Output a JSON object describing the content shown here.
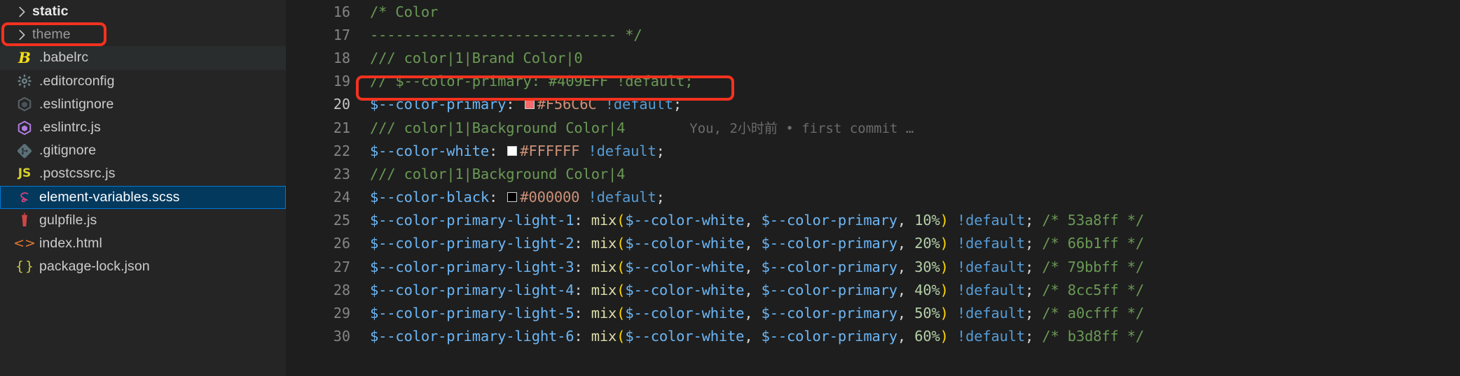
{
  "sidebar": {
    "items": [
      {
        "label": "static",
        "icon": "chevron-right-icon",
        "type": "folder",
        "state": "normal"
      },
      {
        "label": "theme",
        "icon": "chevron-right-icon",
        "type": "folder",
        "state": "annotated"
      },
      {
        "label": ".babelrc",
        "icon": "babel-icon",
        "type": "file",
        "state": "hovered"
      },
      {
        "label": ".editorconfig",
        "icon": "gear-icon",
        "type": "file",
        "state": "normal"
      },
      {
        "label": ".eslintignore",
        "icon": "eslint-gray-icon",
        "type": "file",
        "state": "normal"
      },
      {
        "label": ".eslintrc.js",
        "icon": "eslint-purple-icon",
        "type": "file",
        "state": "normal"
      },
      {
        "label": ".gitignore",
        "icon": "git-icon",
        "type": "file",
        "state": "normal"
      },
      {
        "label": ".postcssrc.js",
        "icon": "js-icon",
        "type": "file",
        "state": "normal"
      },
      {
        "label": "element-variables.scss",
        "icon": "sass-icon",
        "type": "file",
        "state": "selected"
      },
      {
        "label": "gulpfile.js",
        "icon": "gulp-icon",
        "type": "file",
        "state": "normal"
      },
      {
        "label": "index.html",
        "icon": "html-icon",
        "type": "file",
        "state": "normal"
      },
      {
        "label": "package-lock.json",
        "icon": "json-icon",
        "type": "file",
        "state": "normal"
      }
    ]
  },
  "annotations": {
    "sidebar_box_color": "#f3321f",
    "code_box_color": "#f3321f",
    "sidebar_box_target": "theme",
    "code_box_target_line": 20
  },
  "editor": {
    "blame": "You, 2小时前 • first commit …",
    "lines": [
      {
        "num": "16",
        "tokens": [
          {
            "t": "/* Color",
            "c": "cm"
          }
        ]
      },
      {
        "num": "17",
        "tokens": [
          {
            "t": "----------------------------- */",
            "c": "cm"
          }
        ]
      },
      {
        "num": "18",
        "tokens": [
          {
            "t": "/// color|1|Brand Color|0",
            "c": "cm"
          }
        ]
      },
      {
        "num": "19",
        "tokens": [
          {
            "t": "// $--color-primary: #409EFF !default;",
            "c": "cm"
          }
        ]
      },
      {
        "num": "20",
        "current": true,
        "tokens": [
          {
            "t": "$--color-primary",
            "c": "va"
          },
          {
            "t": ": ",
            "c": "pu"
          },
          {
            "t": "",
            "c": "swatch",
            "color": "#F56C6C"
          },
          {
            "t": "#F56C6C",
            "c": "st"
          },
          {
            "t": " ",
            "c": "pu"
          },
          {
            "t": "!default",
            "c": "kw"
          },
          {
            "t": ";",
            "c": "pu"
          }
        ]
      },
      {
        "num": "21",
        "blame": true,
        "tokens": [
          {
            "t": "/// color|1|Background Color|4",
            "c": "cm"
          }
        ]
      },
      {
        "num": "22",
        "tokens": [
          {
            "t": "$--color-white",
            "c": "va"
          },
          {
            "t": ": ",
            "c": "pu"
          },
          {
            "t": "",
            "c": "swatch",
            "color": "#FFFFFF"
          },
          {
            "t": "#FFFFFF",
            "c": "st"
          },
          {
            "t": " ",
            "c": "pu"
          },
          {
            "t": "!default",
            "c": "kw"
          },
          {
            "t": ";",
            "c": "pu"
          }
        ]
      },
      {
        "num": "23",
        "tokens": [
          {
            "t": "/// color|1|Background Color|4",
            "c": "cm"
          }
        ]
      },
      {
        "num": "24",
        "tokens": [
          {
            "t": "$--color-black",
            "c": "va"
          },
          {
            "t": ": ",
            "c": "pu"
          },
          {
            "t": "",
            "c": "swatch",
            "color": "#000000"
          },
          {
            "t": "#000000",
            "c": "st"
          },
          {
            "t": " ",
            "c": "pu"
          },
          {
            "t": "!default",
            "c": "kw"
          },
          {
            "t": ";",
            "c": "pu"
          }
        ]
      },
      {
        "num": "25",
        "tokens": [
          {
            "t": "$--color-primary-light-1",
            "c": "va"
          },
          {
            "t": ": ",
            "c": "pu"
          },
          {
            "t": "mix",
            "c": "fn"
          },
          {
            "t": "(",
            "c": "br"
          },
          {
            "t": "$--color-white",
            "c": "va"
          },
          {
            "t": ", ",
            "c": "pu"
          },
          {
            "t": "$--color-primary",
            "c": "va"
          },
          {
            "t": ", ",
            "c": "pu"
          },
          {
            "t": "10%",
            "c": "nu"
          },
          {
            "t": ")",
            "c": "br"
          },
          {
            "t": " ",
            "c": "pu"
          },
          {
            "t": "!default",
            "c": "kw"
          },
          {
            "t": "; ",
            "c": "pu"
          },
          {
            "t": "/* 53a8ff */",
            "c": "cm"
          }
        ]
      },
      {
        "num": "26",
        "tokens": [
          {
            "t": "$--color-primary-light-2",
            "c": "va"
          },
          {
            "t": ": ",
            "c": "pu"
          },
          {
            "t": "mix",
            "c": "fn"
          },
          {
            "t": "(",
            "c": "br"
          },
          {
            "t": "$--color-white",
            "c": "va"
          },
          {
            "t": ", ",
            "c": "pu"
          },
          {
            "t": "$--color-primary",
            "c": "va"
          },
          {
            "t": ", ",
            "c": "pu"
          },
          {
            "t": "20%",
            "c": "nu"
          },
          {
            "t": ")",
            "c": "br"
          },
          {
            "t": " ",
            "c": "pu"
          },
          {
            "t": "!default",
            "c": "kw"
          },
          {
            "t": "; ",
            "c": "pu"
          },
          {
            "t": "/* 66b1ff */",
            "c": "cm"
          }
        ]
      },
      {
        "num": "27",
        "tokens": [
          {
            "t": "$--color-primary-light-3",
            "c": "va"
          },
          {
            "t": ": ",
            "c": "pu"
          },
          {
            "t": "mix",
            "c": "fn"
          },
          {
            "t": "(",
            "c": "br"
          },
          {
            "t": "$--color-white",
            "c": "va"
          },
          {
            "t": ", ",
            "c": "pu"
          },
          {
            "t": "$--color-primary",
            "c": "va"
          },
          {
            "t": ", ",
            "c": "pu"
          },
          {
            "t": "30%",
            "c": "nu"
          },
          {
            "t": ")",
            "c": "br"
          },
          {
            "t": " ",
            "c": "pu"
          },
          {
            "t": "!default",
            "c": "kw"
          },
          {
            "t": "; ",
            "c": "pu"
          },
          {
            "t": "/* 79bbff */",
            "c": "cm"
          }
        ]
      },
      {
        "num": "28",
        "tokens": [
          {
            "t": "$--color-primary-light-4",
            "c": "va"
          },
          {
            "t": ": ",
            "c": "pu"
          },
          {
            "t": "mix",
            "c": "fn"
          },
          {
            "t": "(",
            "c": "br"
          },
          {
            "t": "$--color-white",
            "c": "va"
          },
          {
            "t": ", ",
            "c": "pu"
          },
          {
            "t": "$--color-primary",
            "c": "va"
          },
          {
            "t": ", ",
            "c": "pu"
          },
          {
            "t": "40%",
            "c": "nu"
          },
          {
            "t": ")",
            "c": "br"
          },
          {
            "t": " ",
            "c": "pu"
          },
          {
            "t": "!default",
            "c": "kw"
          },
          {
            "t": "; ",
            "c": "pu"
          },
          {
            "t": "/* 8cc5ff */",
            "c": "cm"
          }
        ]
      },
      {
        "num": "29",
        "tokens": [
          {
            "t": "$--color-primary-light-5",
            "c": "va"
          },
          {
            "t": ": ",
            "c": "pu"
          },
          {
            "t": "mix",
            "c": "fn"
          },
          {
            "t": "(",
            "c": "br"
          },
          {
            "t": "$--color-white",
            "c": "va"
          },
          {
            "t": ", ",
            "c": "pu"
          },
          {
            "t": "$--color-primary",
            "c": "va"
          },
          {
            "t": ", ",
            "c": "pu"
          },
          {
            "t": "50%",
            "c": "nu"
          },
          {
            "t": ")",
            "c": "br"
          },
          {
            "t": " ",
            "c": "pu"
          },
          {
            "t": "!default",
            "c": "kw"
          },
          {
            "t": "; ",
            "c": "pu"
          },
          {
            "t": "/* a0cfff */",
            "c": "cm"
          }
        ]
      },
      {
        "num": "30",
        "tokens": [
          {
            "t": "$--color-primary-light-6",
            "c": "va"
          },
          {
            "t": ": ",
            "c": "pu"
          },
          {
            "t": "mix",
            "c": "fn"
          },
          {
            "t": "(",
            "c": "br"
          },
          {
            "t": "$--color-white",
            "c": "va"
          },
          {
            "t": ", ",
            "c": "pu"
          },
          {
            "t": "$--color-primary",
            "c": "va"
          },
          {
            "t": ", ",
            "c": "pu"
          },
          {
            "t": "60%",
            "c": "nu"
          },
          {
            "t": ")",
            "c": "br"
          },
          {
            "t": " ",
            "c": "pu"
          },
          {
            "t": "!default",
            "c": "kw"
          },
          {
            "t": "; ",
            "c": "pu"
          },
          {
            "t": "/* b3d8ff */",
            "c": "cm"
          }
        ]
      }
    ]
  }
}
